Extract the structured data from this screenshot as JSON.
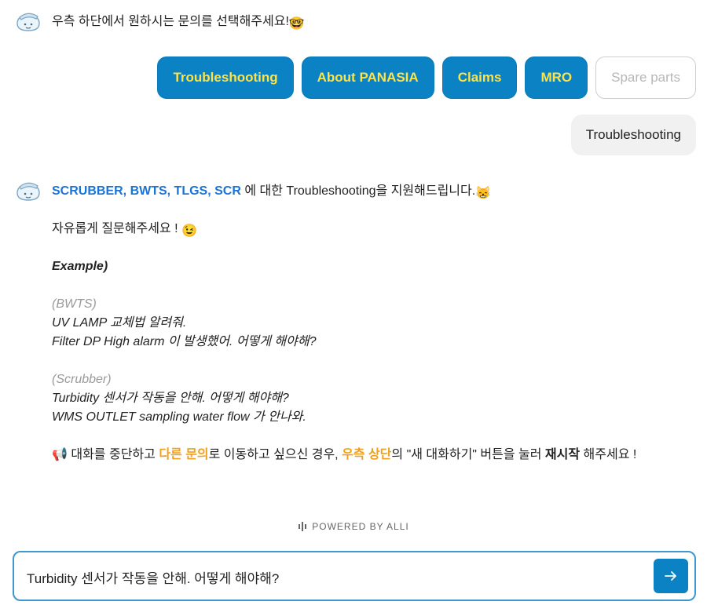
{
  "intro": {
    "message": "우측 하단에서 원하시는 문의를 선택해주세요!",
    "emoji": "🤓"
  },
  "quick_buttons": [
    {
      "label": "Troubleshooting",
      "enabled": true
    },
    {
      "label": "About PANASIA",
      "enabled": true
    },
    {
      "label": "Claims",
      "enabled": true
    },
    {
      "label": "MRO",
      "enabled": true
    },
    {
      "label": "Spare parts",
      "enabled": false
    }
  ],
  "user_message": "Troubleshooting",
  "bot_reply": {
    "topics": "SCRUBBER, BWTS, TLGS, SCR",
    "intro_rest": " 에 대한 Troubleshooting을 지원해드립니다.",
    "intro_emoji": "😸",
    "free_ask": "자유롭게 질문해주세요 ! ",
    "free_ask_emoji": "😉",
    "example_title": "Example)",
    "bwts_tag": "(BWTS)",
    "bwts_q1": "UV LAMP 교체법 알려줘.",
    "bwts_q2": "Filter DP High alarm 이 발생했어. 어떻게 해야해?",
    "scrubber_tag": "(Scrubber)",
    "scrubber_q1": "Turbidity 센서가 작동을 안해. 어떻게 해야해?",
    "scrubber_q2": "WMS OUTLET sampling water flow 가 안나와.",
    "notice_emoji": "📢",
    "notice_p1": " 대화를 중단하고 ",
    "notice_hl1": "다른 문의",
    "notice_p2": "로 이동하고 싶으신 경우, ",
    "notice_hl2": "우측 상단",
    "notice_p3": "의 \"새 대화하기\" 버튼을 눌러 ",
    "notice_bold": "재시작",
    "notice_p4": " 해주세요 !"
  },
  "footer": {
    "powered_by": "POWERED BY ALLI"
  },
  "input": {
    "value": "Turbidity 센서가 작동을 안해. 어떻게 해야해?"
  },
  "colors": {
    "accent": "#0a82c3",
    "button_text": "#fde34a",
    "highlight_blue": "#1a73d6",
    "highlight_orange": "#f0a020"
  },
  "icons": {
    "bot_avatar": "bot-avatar-icon",
    "send": "arrow-right-icon",
    "megaphone": "megaphone-icon"
  }
}
